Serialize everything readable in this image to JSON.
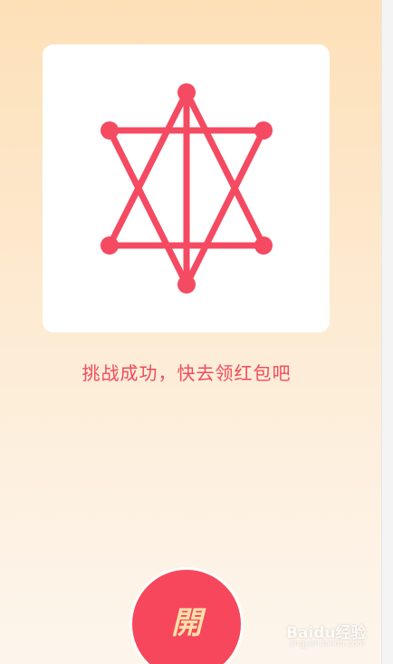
{
  "puzzle": {
    "line_color": "#f44a62",
    "status": "completed"
  },
  "message": "挑战成功，快去领红包吧",
  "open_button": {
    "label": "開"
  },
  "watermark": {
    "text": "Baidu经验",
    "sub": "jingyan.baidu.com"
  }
}
